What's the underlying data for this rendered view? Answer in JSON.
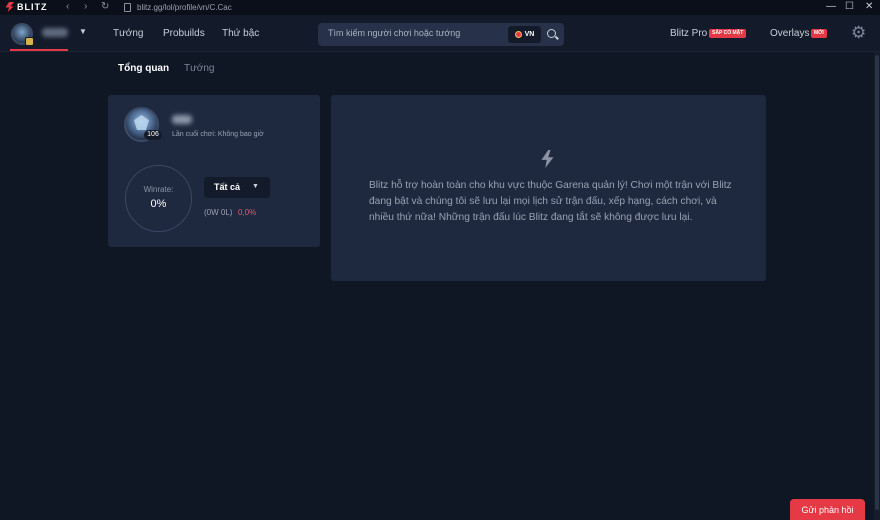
{
  "titlebar": {
    "logo_text": "BLITZ",
    "back_icon": "chevron-left-icon",
    "forward_icon": "chevron-right-icon",
    "reload_icon": "reload-icon",
    "url": "blitz.gg/lol/profile/vn/C.Cac",
    "minimize": "—",
    "maximize": "☐",
    "close": "✕"
  },
  "topnav": {
    "links": [
      "Tướng",
      "Probuilds",
      "Thứ bậc"
    ],
    "search_placeholder": "Tìm kiếm người chơi hoặc tướng",
    "region": "VN",
    "blitz_pro": "Blitz Pro",
    "blitz_pro_tag": "SẮP CÓ MẶT",
    "overlays": "Overlays",
    "overlays_tag": "MỚI",
    "settings_icon": "gear-icon"
  },
  "tabs": [
    "Tổng quan",
    "Tướng"
  ],
  "profile": {
    "level": "106",
    "last_played": "Lần cuối chơi: Không bao giờ",
    "winrate_label": "Winrate:",
    "winrate_value": "0%",
    "filter": "Tất cả",
    "record": "(0W 0L)",
    "kda": "0,0%"
  },
  "info": {
    "icon": "lightning-icon",
    "message": "Blitz hỗ trợ hoàn toàn cho khu vực thuộc Garena quản lý! Chơi một trận với Blitz đang bật và chúng tôi sẽ lưu lại mọi lịch sử trận đấu, xếp hạng, cách chơi, và nhiều thứ nữa! Những trận đấu lúc Blitz đang tắt sẽ không được lưu lại."
  },
  "feedback_label": "Gửi phản hồi",
  "colors": {
    "background": "#0f1624",
    "card": "#1e2940",
    "accent": "#e63946"
  }
}
